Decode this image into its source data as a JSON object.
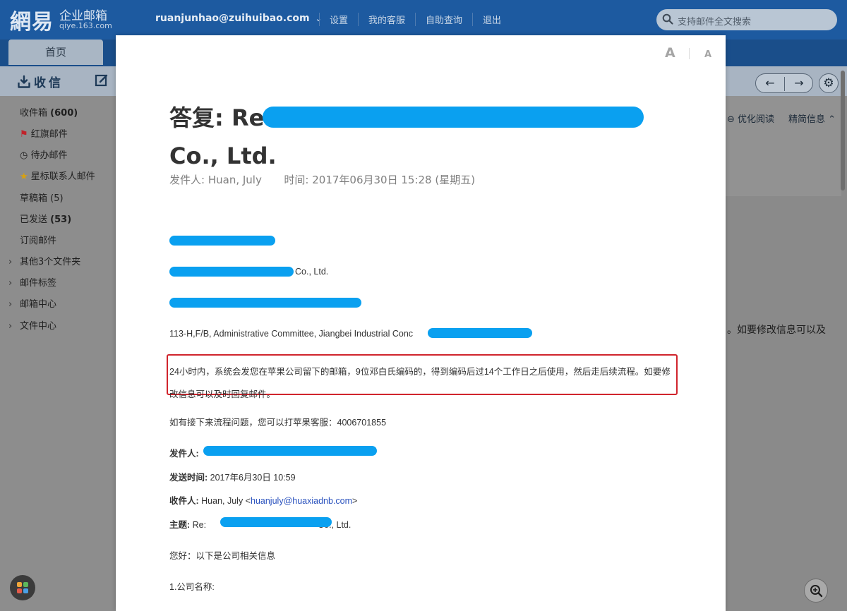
{
  "header": {
    "logo_mark": "網易",
    "logo_product": "企业邮箱",
    "logo_domain": "qiye.163.com",
    "account": "ruanjunhao@zuihuibao.com",
    "links": [
      "设置",
      "我的客服",
      "自助查询",
      "退出"
    ],
    "search_placeholder": "支持邮件全文搜索"
  },
  "tabs": {
    "home": "首页"
  },
  "toolbar": {
    "receive": "收信"
  },
  "sidebar": {
    "inbox_label": "收件箱",
    "inbox_count": "(600)",
    "flagged": "红旗邮件",
    "todo": "待办邮件",
    "starred": "星标联系人邮件",
    "drafts": "草稿箱 (5)",
    "sent_label": "已发送",
    "sent_count": "(53)",
    "subscribed": "订阅邮件",
    "folders": [
      "其他3个文件夹",
      "邮件标签",
      "邮箱中心",
      "文件中心"
    ]
  },
  "right_panel": {
    "optimize": "优化阅读",
    "brief": "精简信息",
    "snippet": "。如要修改信息可以及"
  },
  "reader": {
    "font_large": "A",
    "font_small": "A",
    "subject_line1": "答复: Re:",
    "subject_line2": "Co., Ltd.",
    "sender_label": "发件人:",
    "sender_name": "Huan, July",
    "time_label": "时间:",
    "time_value": "2017年06月30日 15:28 (星期五)",
    "body": {
      "company_en_suffix": "Co., Ltd.",
      "address_en": "113-H,F/B, Administrative Committee, Jiangbei Industrial Conc",
      "highlight_text": "24小时内，系统会发您在苹果公司留下的邮箱，9位邓白氏编码的，得到编码后过14个工作日之后使用，然后走后续流程。如要修改信息可以及时回复邮件。",
      "contact_line": "如有接下来流程问题，您可以打苹果客服：4006701855",
      "from_label": "发件人:",
      "sent_label": "发送时间:",
      "sent_value": "2017年6月30日 10:59",
      "to_label": "收件人:",
      "to_name": "Huan, July <",
      "to_email": "huanjuly@huaxiadnb.com",
      "to_close": ">",
      "subject_label": "主题:",
      "subject_prefix": "Re:",
      "subject_suffix": "Co., Ltd.",
      "greeting": "您好：以下是公司相关信息",
      "item1": "1.公司名称:"
    }
  },
  "colors": {
    "redaction": "#0aa0f0",
    "highlight_border": "#d0242c",
    "link": "#2a52be"
  }
}
